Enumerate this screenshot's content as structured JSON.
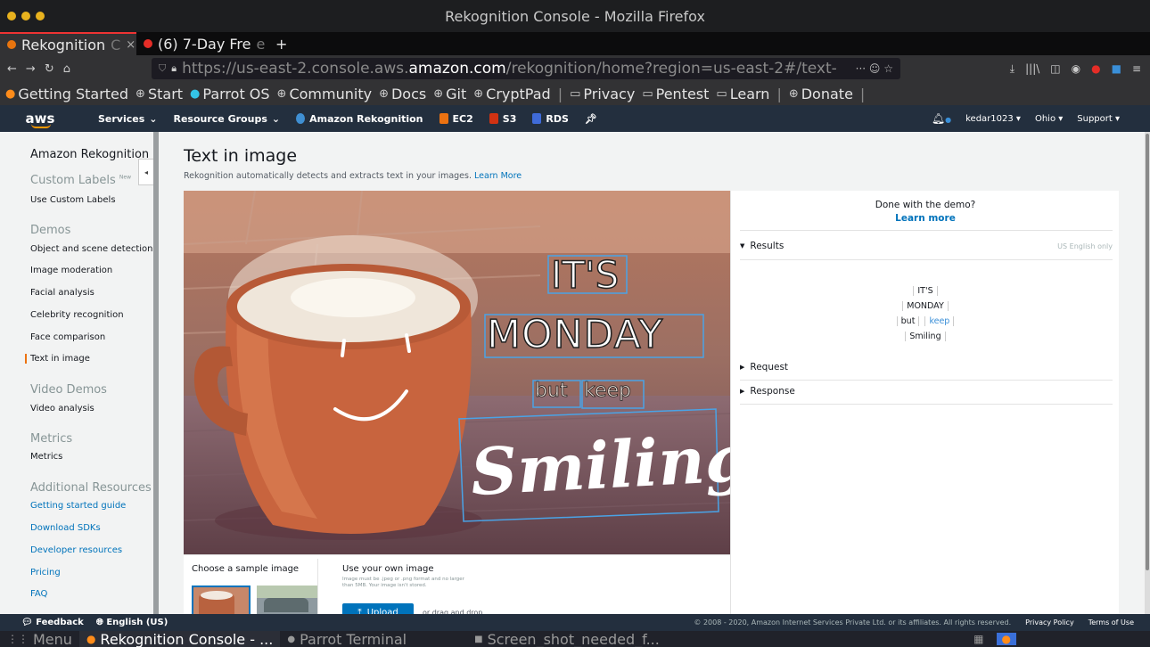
{
  "window": {
    "title": "Rekognition Console - Mozilla Firefox"
  },
  "tabs": [
    {
      "label": "Rekognition",
      "fade": " C",
      "close": "×",
      "color": "#e8740e"
    },
    {
      "label": "(6) 7-Day Fre",
      "fade": "e",
      "close": "×",
      "color": "#e52d27"
    }
  ],
  "new_tab": "+",
  "url": {
    "prefix": "https://us-east-2.console.aws.",
    "domain": "amazon.com",
    "path": "/rekognition/home?region=us-east-2#/text-",
    "more": "··· ☺ ☆"
  },
  "bookmarks": [
    {
      "label": "Getting Started",
      "icon": "firefox-icon"
    },
    {
      "label": "Start",
      "icon": "globe-icon"
    },
    {
      "label": "Parrot OS",
      "icon": "parrot-icon"
    },
    {
      "label": "Community",
      "icon": "globe-icon"
    },
    {
      "label": "Docs",
      "icon": "globe-icon"
    },
    {
      "label": "Git",
      "icon": "globe-icon"
    },
    {
      "label": "CryptPad",
      "icon": "globe-icon"
    },
    {
      "label": "Privacy",
      "icon": "folder-icon"
    },
    {
      "label": "Pentest",
      "icon": "folder-icon"
    },
    {
      "label": "Learn",
      "icon": "folder-icon"
    },
    {
      "label": "Donate",
      "icon": "globe-icon"
    }
  ],
  "aws": {
    "logo": "aws",
    "services": "Services",
    "resource_groups": "Resource Groups",
    "shortcuts": [
      {
        "label": "Amazon Rekognition",
        "color": "#3f8fd2"
      },
      {
        "label": "EC2",
        "color": "#ec7211"
      },
      {
        "label": "S3",
        "color": "#d13212"
      },
      {
        "label": "RDS",
        "color": "#3f6bd8"
      }
    ],
    "user": "kedar1023",
    "region": "Ohio",
    "support": "Support"
  },
  "sidebar": {
    "title": "Amazon Rekognition",
    "custom_labels": "Custom Labels",
    "new_badge": "New",
    "use_custom_labels": "Use Custom Labels",
    "demos_head": "Demos",
    "demos": [
      "Object and scene detection",
      "Image moderation",
      "Facial analysis",
      "Celebrity recognition",
      "Face comparison"
    ],
    "active": "Text in image",
    "video_head": "Video Demos",
    "video_analysis": "Video analysis",
    "metrics_head": "Metrics",
    "metrics": "Metrics",
    "resources_head": "Additional Resources",
    "resources": [
      "Getting started guide",
      "Download SDKs",
      "Developer resources",
      "Pricing",
      "FAQ"
    ]
  },
  "main": {
    "title": "Text in image",
    "subtitle": "Rekognition automatically detects and extracts text in your images.",
    "learn_more": "Learn More",
    "image_words": {
      "its": "IT'S",
      "monday": "MONDAY",
      "but": "but",
      "keep": "keep",
      "smiling": "Smiling"
    },
    "sample_label": "Choose a sample image",
    "own_label": "Use your own image",
    "own_hint": "Image must be .jpeg or .png format and no larger than 5MB. Your image isn't stored.",
    "upload": "Upload",
    "drag": "or drag and drop"
  },
  "results_panel": {
    "done": "Done with the demo?",
    "learn_more": "Learn more",
    "results": "Results",
    "lang": "US English only",
    "lines": [
      [
        "IT'S"
      ],
      [
        "MONDAY"
      ],
      [
        "but",
        "keep"
      ],
      [
        "Smiling"
      ]
    ],
    "request": "Request",
    "response": "Response"
  },
  "status": {
    "feedback": "Feedback",
    "language": "English (US)",
    "copyright": "© 2008 - 2020, Amazon Internet Services Private Ltd. or its affiliates. All rights reserved.",
    "privacy": "Privacy Policy",
    "terms": "Terms of Use"
  },
  "taskbar": [
    {
      "label": "Menu",
      "icon": "menu-icon"
    },
    {
      "label": "Rekognition Console - ...",
      "icon": "firefox-icon",
      "active": true
    },
    {
      "label": "Parrot Terminal",
      "icon": "terminal-icon"
    },
    {
      "label": "Screen_shot_needed_f...",
      "icon": "folder-icon"
    }
  ]
}
